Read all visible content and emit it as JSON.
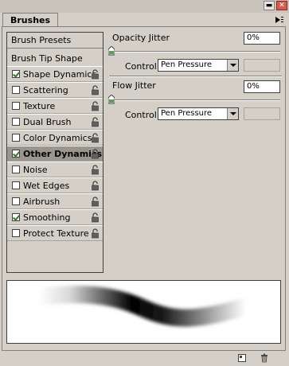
{
  "window": {
    "tab_title": "Brushes",
    "minimize_symbol": "▬",
    "close_symbol": "✕"
  },
  "left_panel": {
    "presets_label": "Brush Presets",
    "tip_shape_label": "Brush Tip Shape",
    "items": [
      {
        "label": "Shape Dynamics",
        "checked": true,
        "lock": true
      },
      {
        "label": "Scattering",
        "checked": false,
        "lock": true
      },
      {
        "label": "Texture",
        "checked": false,
        "lock": true
      },
      {
        "label": "Dual Brush",
        "checked": false,
        "lock": true
      },
      {
        "label": "Color Dynamics",
        "checked": false,
        "lock": true
      },
      {
        "label": "Other Dynamics",
        "checked": true,
        "lock": true,
        "selected": true
      },
      {
        "label": "Noise",
        "checked": false,
        "lock": true
      },
      {
        "label": "Wet Edges",
        "checked": false,
        "lock": true
      },
      {
        "label": "Airbrush",
        "checked": false,
        "lock": true
      },
      {
        "label": "Smoothing",
        "checked": true,
        "lock": true
      },
      {
        "label": "Protect Texture",
        "checked": false,
        "lock": true
      }
    ]
  },
  "right_panel": {
    "opacity_jitter": {
      "label": "Opacity Jitter",
      "value": "0%",
      "slider_value": 0
    },
    "opacity_control": {
      "label": "Control:",
      "value": "Pen Pressure"
    },
    "flow_jitter": {
      "label": "Flow Jitter",
      "value": "0%",
      "slider_value": 0
    },
    "flow_control": {
      "label": "Control:",
      "value": "Pen Pressure"
    }
  },
  "footer": {
    "icons": [
      "new-brush-icon",
      "trash-icon"
    ]
  },
  "colors": {
    "panel_bg": "#d4d0c8",
    "selected_item_bg": "#9a968e",
    "check_green": "#2a7a2a",
    "close_red": "#d85a4a"
  }
}
